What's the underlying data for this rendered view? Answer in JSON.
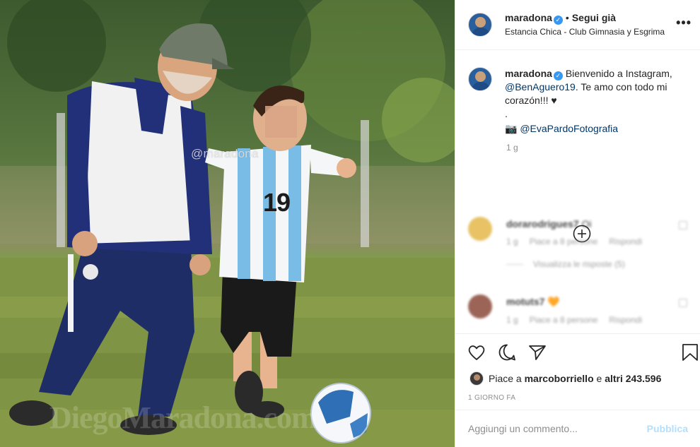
{
  "post": {
    "watermark_label": "@maradona",
    "watermark_banner": "DiegoMaradona.com",
    "shirt_number": "19"
  },
  "header": {
    "username": "maradona",
    "verified_glyph": "✓",
    "separator": "•",
    "follow_status": "Segui già",
    "location": "Estancia Chica - Club Gimnasia y Esgrima",
    "more_icon": "more-horizontal-icon"
  },
  "caption": {
    "username": "maradona",
    "text_before": "Bienvenido a Instagram, ",
    "mention": "@BenAguero19",
    "text_after": ". Te amo con todo mi corazón!!! ♥",
    "dot": ".",
    "camera_glyph": "📷",
    "credit": "@EvaPardoFotografia",
    "time": "1 g"
  },
  "load_more_icon": "plus-circle-icon",
  "comments": [
    {
      "username": "dorarodrigues7",
      "text": "Oi",
      "time": "1 g",
      "likes": "Piace a 8 persone",
      "reply": "Rispondi",
      "replies": "Visualizza le risposte (5)",
      "avatar_color": "#e4b84a"
    },
    {
      "username": "motuts7",
      "text": "🧡",
      "time": "1 g",
      "likes": "Piace a 8 persone",
      "reply": "Rispondi",
      "avatar_color": "#8a4a3a"
    }
  ],
  "actions": {
    "like_icon": "heart-icon",
    "comment_icon": "comment-icon",
    "share_icon": "send-icon",
    "save_icon": "bookmark-icon"
  },
  "likes": {
    "prefix": "Piace a ",
    "user": "marcoborriello",
    "middle": " e ",
    "others": "altri 243.596"
  },
  "timeago": "1 GIORNO FA",
  "comment_box": {
    "placeholder": "Aggiungi un commento...",
    "publish": "Pubblica"
  },
  "colors": {
    "link": "#00376b",
    "verified": "#3897f0",
    "publish_disabled": "#b2dffc",
    "muted": "#8e8e8e"
  }
}
